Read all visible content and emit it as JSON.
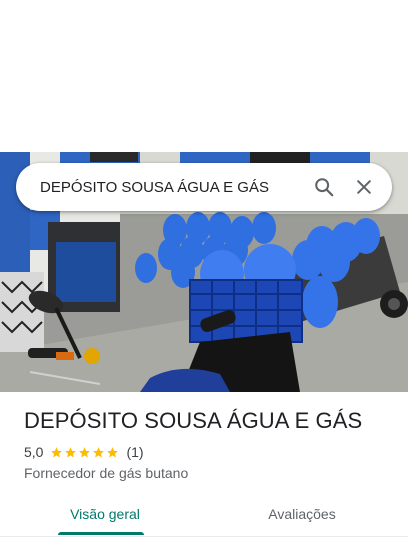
{
  "search": {
    "query": "DEPÓSITO SOUSA ÁGUA E GÁS"
  },
  "place": {
    "title": "DEPÓSITO SOUSA ÁGUA E GÁS",
    "rating": "5,0",
    "stars": 5,
    "review_count": "(1)",
    "category": "Fornecedor de gás butano"
  },
  "tabs": [
    {
      "label": "Visão geral",
      "active": true
    },
    {
      "label": "Avaliações",
      "active": false
    }
  ],
  "icons": {
    "search": "search-icon",
    "close": "close-icon",
    "star": "star-icon"
  },
  "colors": {
    "accent": "#00796b",
    "star": "#fbbc04",
    "text": "#202124",
    "secondary": "#5f6368"
  }
}
